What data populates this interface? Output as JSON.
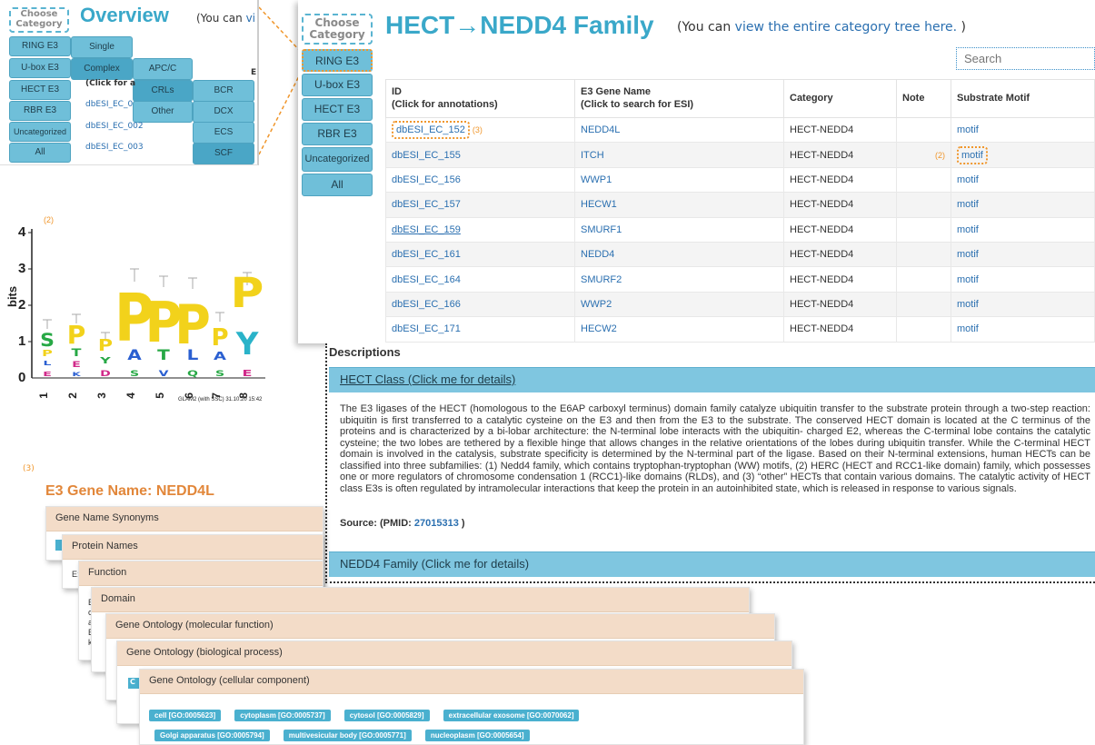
{
  "overview": {
    "choose_line1": "Choose",
    "choose_line2": "Category",
    "title": "Overview",
    "note_prefix": "(You can",
    "note_link": "vi",
    "categories": [
      "RING E3",
      "U-box E3",
      "HECT E3",
      "RBR E3",
      "Uncategorized",
      "All"
    ],
    "level2": [
      "Single",
      "Complex"
    ],
    "level3": [
      "APC/C",
      "CRLs",
      "Other"
    ],
    "level4": [
      "BCR",
      "DCX",
      "ECS",
      "SCF"
    ],
    "clip_header": "(Click for a",
    "clip_col": "E",
    "ids": [
      "dbESI_EC_0",
      "dbESI_EC_002",
      "dbESI_EC_003"
    ]
  },
  "family": {
    "choose_line1": "Choose",
    "choose_line2": "Category",
    "categories": [
      "RING E3",
      "U-box E3",
      "HECT E3",
      "RBR E3",
      "Uncategorized",
      "All"
    ],
    "title": "HECT→NEDD4 Family",
    "note_prefix": "(You can",
    "note_link": "view the entire category tree here.",
    "note_suffix": ")",
    "search_placeholder": "Search",
    "columns": {
      "id_line1": "ID",
      "id_line2": "(Click for annotations)",
      "gene_line1": "E3 Gene Name",
      "gene_line2": "(Click to search for ESI)",
      "category": "Category",
      "note": "Note",
      "motif": "Substrate Motif"
    },
    "rows": [
      {
        "id": "dbESI_EC_152",
        "gene": "NEDD4L",
        "category": "HECT-NEDD4",
        "note": "",
        "motif": "motif"
      },
      {
        "id": "dbESI_EC_155",
        "gene": "ITCH",
        "category": "HECT-NEDD4",
        "note": "",
        "motif": "motif"
      },
      {
        "id": "dbESI_EC_156",
        "gene": "WWP1",
        "category": "HECT-NEDD4",
        "note": "",
        "motif": "motif"
      },
      {
        "id": "dbESI_EC_157",
        "gene": "HECW1",
        "category": "HECT-NEDD4",
        "note": "",
        "motif": "motif"
      },
      {
        "id": "dbESI_EC_159",
        "gene": "SMURF1",
        "category": "HECT-NEDD4",
        "note": "",
        "motif": "motif"
      },
      {
        "id": "dbESI_EC_161",
        "gene": "NEDD4",
        "category": "HECT-NEDD4",
        "note": "",
        "motif": "motif"
      },
      {
        "id": "dbESI_EC_164",
        "gene": "SMURF2",
        "category": "HECT-NEDD4",
        "note": "",
        "motif": "motif"
      },
      {
        "id": "dbESI_EC_166",
        "gene": "WWP2",
        "category": "HECT-NEDD4",
        "note": "",
        "motif": "motif"
      },
      {
        "id": "dbESI_EC_171",
        "gene": "HECW2",
        "category": "HECT-NEDD4",
        "note": "",
        "motif": "motif"
      }
    ],
    "annotation_3": "(3)",
    "annotation_2": "(2)"
  },
  "logo": {
    "annotation": "(2)",
    "ylabel": "bits",
    "yticks": [
      "4",
      "3",
      "2",
      "1",
      "0"
    ],
    "xticks": [
      "1",
      "2",
      "3",
      "4",
      "5",
      "6",
      "7",
      "8"
    ],
    "caption": "GLAM2 (with SSC) 31.10.20 15:42"
  },
  "descriptions": {
    "heading": "Descriptions",
    "hect_bar": "HECT Class (Click me for details)",
    "body": "The E3 ligases of the HECT (homologous to the E6AP carboxyl terminus) domain family catalyze ubiquitin transfer to the substrate protein through a two-step reaction: ubiquitin is first transferred to a catalytic cysteine on the E3 and then from the E3 to the substrate. The conserved HECT domain is located at the C terminus of the proteins and is characterized by a bi-lobar architecture: the N-terminal lobe interacts with the ubiquitin- charged E2, whereas the C-terminal lobe contains the catalytic cysteine; the two lobes are tethered by a flexible hinge that allows changes in the relative orientations of the lobes during ubiquitin transfer. While the C-terminal HECT domain is involved in the catalysis, substrate specificity is determined by the N-terminal part of the ligase. Based on their N-terminal extensions, human HECTs can be classified into three subfamilies: (1) Nedd4 family, which contains tryptophan-tryptophan (WW) motifs, (2) HERC (HECT and RCC1-like domain) family, which possesses one or more regulators of chromosome condensation 1 (RCC1)-like domains (RLDs), and (3) “other” HECTs that contain various domains. The catalytic activity of HECT class E3s is often regulated by intramolecular interactions that keep the protein in an autoinhibited state, which is released in response to various signals.",
    "source_label": "Source: (PMID:",
    "source_pmid": "27015313",
    "source_close": ")",
    "nedd4_bar": "NEDD4 Family (Click me for details)"
  },
  "gene": {
    "annotation": "(3)",
    "title": "E3 Gene Name: NEDD4L",
    "sections": [
      "Gene Name Synonyms",
      "Protein Names",
      "Function",
      "Domain",
      "Gene Ontology (molecular function)",
      "Gene Ontology (biological process)",
      "Gene Ontology (cellular component)"
    ],
    "stubs": {
      "protein": "E:",
      "function_lines": [
        "E",
        "c",
        "a",
        "E",
        "k"
      ],
      "bp": "C"
    },
    "cc_terms_row1": [
      "cell [GO:0005623]",
      "cytoplasm [GO:0005737]",
      "cytosol [GO:0005829]",
      "extracellular exosome [GO:0070062]"
    ],
    "cc_terms_row2": [
      "Golgi apparatus [GO:0005794]",
      "multivesicular body [GO:0005771]",
      "nucleoplasm [GO:0005654]"
    ]
  },
  "colors": {
    "accent": "#3aa8c9",
    "button": "#6fbfd9",
    "highlight": "#f0962b",
    "gene_title": "#e2873a",
    "card_header": "#f3dcc8"
  }
}
